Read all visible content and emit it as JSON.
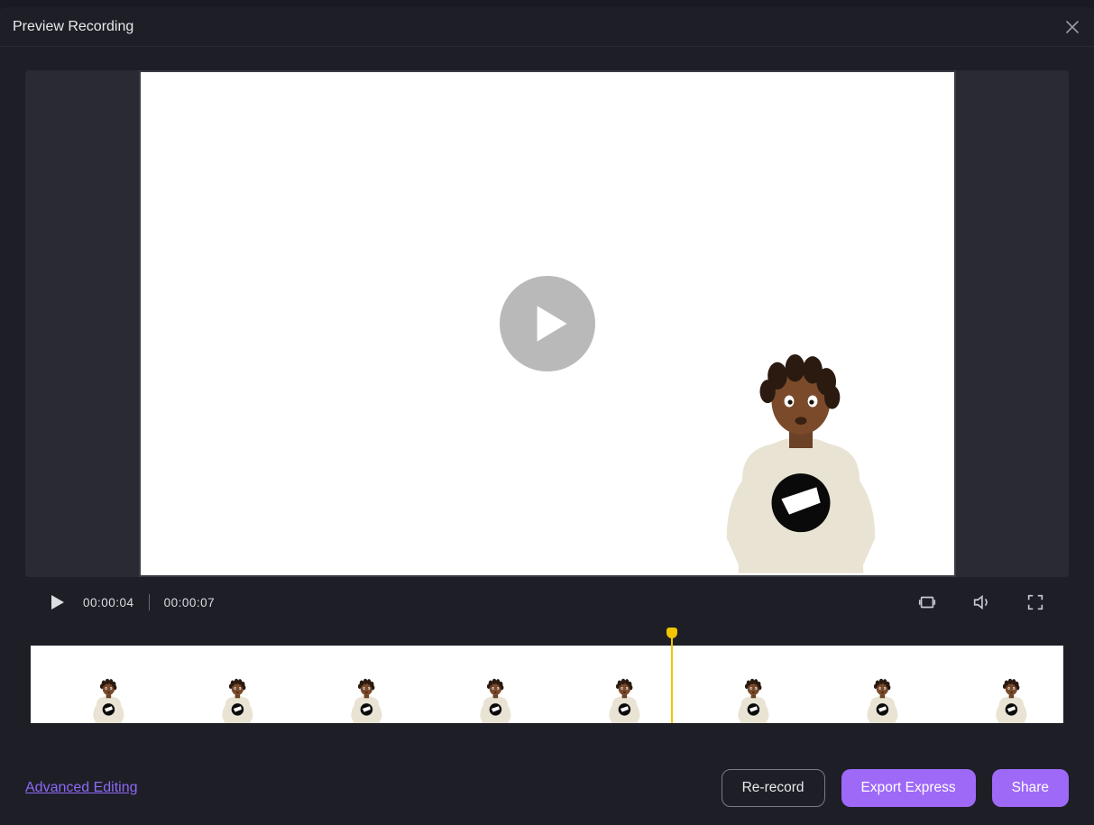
{
  "header": {
    "title": "Preview Recording"
  },
  "player": {
    "current_time": "00:00:04",
    "total_time": "00:00:07",
    "playhead_percent": 62,
    "thumbnail_count": 8
  },
  "controls": {
    "play_icon": "play-icon",
    "trim_icon": "trim-icon",
    "volume_icon": "volume-icon",
    "fullscreen_icon": "fullscreen-icon"
  },
  "footer": {
    "advanced_link": "Advanced Editing",
    "rerecord_label": "Re-record",
    "export_label": "Export Express",
    "share_label": "Share"
  }
}
